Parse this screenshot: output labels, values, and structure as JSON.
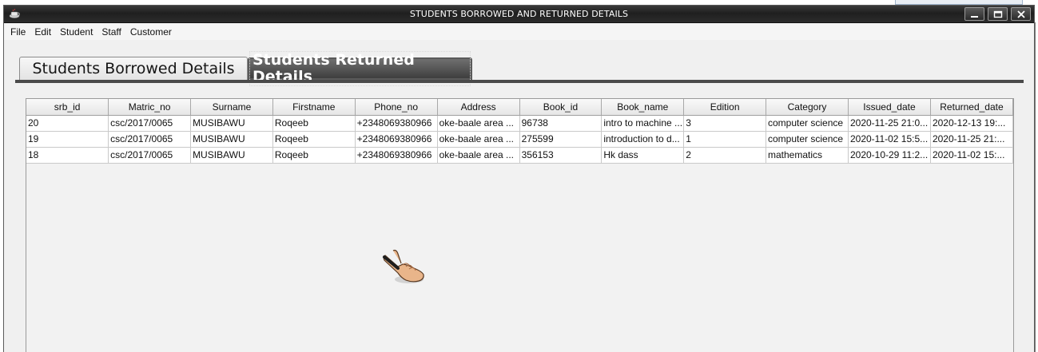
{
  "window": {
    "title": "STUDENTS BORROWED AND RETURNED DETAILS"
  },
  "menu": [
    "File",
    "Edit",
    "Student",
    "Staff",
    "Customer"
  ],
  "tabs": {
    "borrowed": "Students Borrowed Details",
    "returned": "Students Returned Details",
    "active": "returned"
  },
  "table": {
    "columns": [
      "srb_id",
      "Matric_no",
      "Surname",
      "Firstname",
      "Phone_no",
      "Address",
      "Book_id",
      "Book_name",
      "Edition",
      "Category",
      "Issued_date",
      "Returned_date"
    ],
    "rows": [
      [
        "20",
        "csc/2017/0065",
        "MUSIBAWU",
        "Roqeeb",
        "+2348069380966",
        "oke-baale area ...",
        "96738",
        "intro to machine ...",
        "3",
        "computer science",
        "2020-11-25 21:0...",
        "2020-12-13 19:..."
      ],
      [
        "19",
        "csc/2017/0065",
        "MUSIBAWU",
        "Roqeeb",
        "+2348069380966",
        "oke-baale area ...",
        "275599",
        "introduction to d...",
        "1",
        "computer science",
        "2020-11-02 15:5...",
        "2020-11-25 21:..."
      ],
      [
        "18",
        "csc/2017/0065",
        "MUSIBAWU",
        "Roqeeb",
        "+2348069380966",
        "oke-baale area ...",
        "356153",
        "Hk dass",
        "2",
        "mathematics",
        "2020-10-29 11:2...",
        "2020-11-02 15:..."
      ]
    ]
  },
  "icons": {
    "app": "java-cup-icon",
    "minimize": "minimize-icon",
    "maximize": "maximize-icon",
    "close": "close-icon",
    "cursor": "hand-pointer-icon"
  }
}
